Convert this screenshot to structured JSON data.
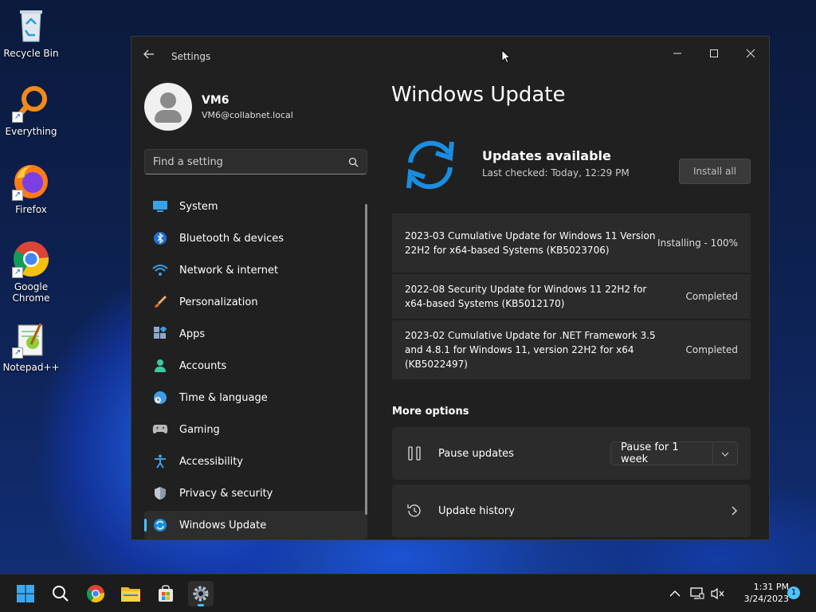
{
  "desktop": {
    "icons": [
      {
        "label": "Recycle Bin"
      },
      {
        "label": "Everything"
      },
      {
        "label": "Firefox"
      },
      {
        "label": "Google Chrome"
      },
      {
        "label": "Notepad++"
      }
    ]
  },
  "window": {
    "title": "Settings",
    "controls": {
      "minimize": "—",
      "maximize": "☐",
      "close": "✕"
    }
  },
  "profile": {
    "name": "VM6",
    "email": "VM6@collabnet.local"
  },
  "search": {
    "placeholder": "Find a setting"
  },
  "nav": {
    "items": [
      {
        "label": "System",
        "icon": "system-icon"
      },
      {
        "label": "Bluetooth & devices",
        "icon": "bluetooth-icon"
      },
      {
        "label": "Network & internet",
        "icon": "wifi-icon"
      },
      {
        "label": "Personalization",
        "icon": "brush-icon"
      },
      {
        "label": "Apps",
        "icon": "apps-icon"
      },
      {
        "label": "Accounts",
        "icon": "account-icon"
      },
      {
        "label": "Time & language",
        "icon": "globe-icon"
      },
      {
        "label": "Gaming",
        "icon": "gamepad-icon"
      },
      {
        "label": "Accessibility",
        "icon": "accessibility-icon"
      },
      {
        "label": "Privacy & security",
        "icon": "shield-icon"
      },
      {
        "label": "Windows Update",
        "icon": "update-icon",
        "active": true
      }
    ]
  },
  "main": {
    "title": "Windows Update",
    "status_title": "Updates available",
    "status_sub": "Last checked: Today, 12:29 PM",
    "install_all_label": "Install all",
    "updates": [
      {
        "name": "2023-03 Cumulative Update for Windows 11 Version 22H2 for x64-based Systems (KB5023706)",
        "status": "Installing - 100%"
      },
      {
        "name": "2022-08 Security Update for Windows 11 22H2 for x64-based Systems (KB5012170)",
        "status": "Completed"
      },
      {
        "name": "2023-02 Cumulative Update for .NET Framework 3.5 and 4.8.1 for Windows 11, version 22H2 for x64 (KB5022497)",
        "status": "Completed"
      }
    ],
    "more_options_label": "More options",
    "pause_label": "Pause updates",
    "pause_selected": "Pause for 1 week",
    "history_label": "Update history"
  },
  "taskbar": {
    "time": "1:31 PM",
    "date": "3/24/2023",
    "notification_count": "1"
  },
  "colors": {
    "accent": "#4cc2ff",
    "update_blue": "#1b8de0"
  }
}
